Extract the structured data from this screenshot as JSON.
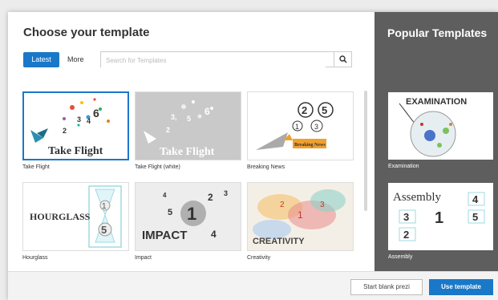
{
  "dialog": {
    "title": "Choose your template",
    "tabs": {
      "latest": "Latest",
      "more": "More"
    },
    "search": {
      "placeholder": "Search for Templates"
    },
    "templates": [
      {
        "label": "Take Flight",
        "thumb_text": "Take Flight"
      },
      {
        "label": "Take Flight (white)",
        "thumb_text": "Take Flight"
      },
      {
        "label": "Breaking News",
        "thumb_text": "Breaking News"
      },
      {
        "label": "Hourglass",
        "thumb_text": "HOURGLASS"
      },
      {
        "label": "Impact",
        "thumb_text": "IMPACT"
      },
      {
        "label": "Creativity",
        "thumb_text": "CREATIVITY"
      }
    ]
  },
  "popular": {
    "title": "Popular Templates",
    "items": [
      {
        "label": "Examination",
        "thumb_text": "EXAMINATION"
      },
      {
        "label": "Assembly",
        "thumb_text": "Assembly"
      }
    ]
  },
  "footer": {
    "blank_label": "Start blank prezi",
    "use_label": "Use template"
  },
  "colors": {
    "accent": "#1a78c8",
    "popular_bg": "#5e5e5e"
  }
}
